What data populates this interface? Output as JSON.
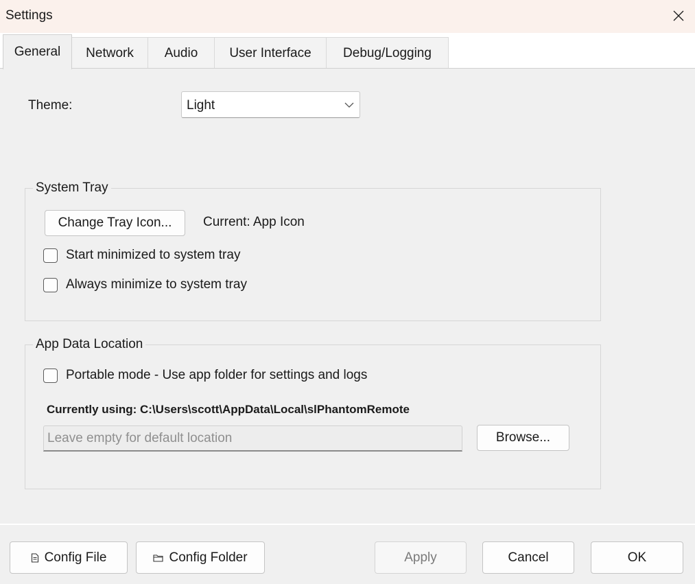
{
  "window": {
    "title": "Settings"
  },
  "tabs": [
    "General",
    "Network",
    "Audio",
    "User Interface",
    "Debug/Logging"
  ],
  "general": {
    "theme_label": "Theme:",
    "theme_value": "Light",
    "system_tray": {
      "title": "System Tray",
      "change_icon_button": "Change Tray Icon...",
      "current_icon": "Current: App Icon",
      "start_minimized": "Start minimized to system tray",
      "always_minimize": "Always minimize to system tray"
    },
    "app_data": {
      "title": "App Data Location",
      "portable_mode": "Portable mode - Use app folder for settings and logs",
      "currently_using": "Currently using: C:\\Users\\scott\\AppData\\Local\\slPhantomRemote",
      "path_placeholder": "Leave empty for default location",
      "browse_button": "Browse..."
    }
  },
  "footer": {
    "config_file": "Config File",
    "config_folder": "Config Folder",
    "apply": "Apply",
    "cancel": "Cancel",
    "ok": "OK"
  },
  "icons": {
    "close": "close-icon",
    "dropdown": "chevron-down-icon",
    "config_file": "document-icon",
    "config_folder": "folder-icon"
  }
}
